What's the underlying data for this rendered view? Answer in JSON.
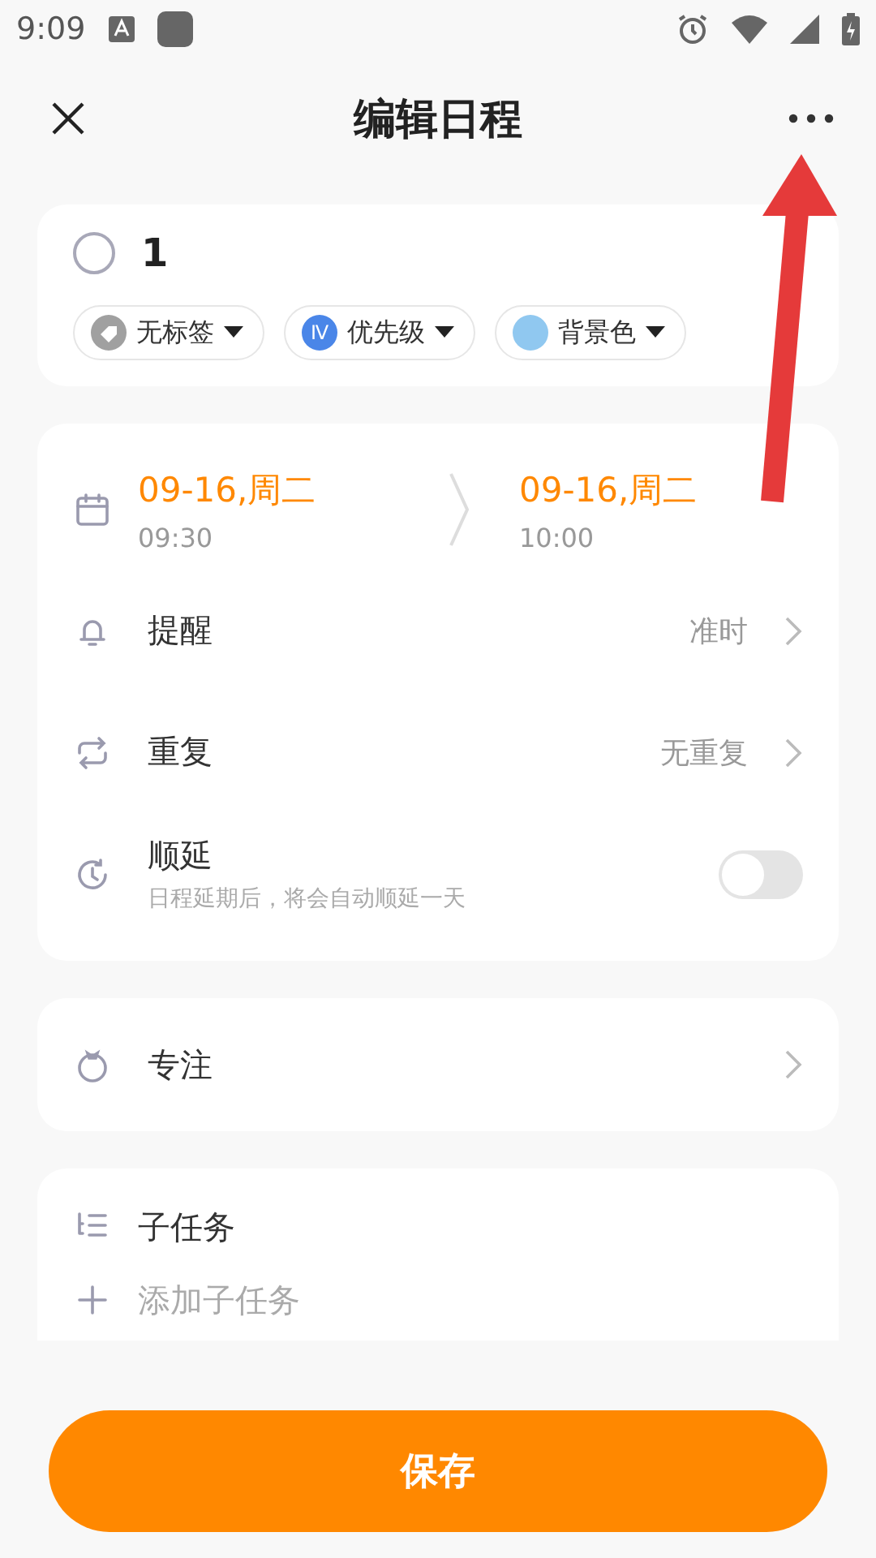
{
  "status_bar": {
    "time": "9:09"
  },
  "header": {
    "title": "编辑日程"
  },
  "task": {
    "checked": false,
    "title": "1",
    "chips": [
      {
        "kind": "tag",
        "label": "无标签"
      },
      {
        "kind": "priority",
        "label": "优先级",
        "badge": "Ⅳ"
      },
      {
        "kind": "color",
        "label": "背景色",
        "color": "#90c8f0"
      }
    ]
  },
  "schedule": {
    "start": {
      "date": "09-16,周二",
      "time": "09:30"
    },
    "end": {
      "date": "09-16,周二",
      "time": "10:00"
    },
    "rows": [
      {
        "kind": "nav",
        "label": "提醒",
        "value": "准时"
      },
      {
        "kind": "nav",
        "label": "重复",
        "value": "无重复"
      },
      {
        "kind": "toggle",
        "label": "顺延",
        "hint": "日程延期后，将会自动顺延一天",
        "on": false
      }
    ]
  },
  "focus": {
    "label": "专注"
  },
  "subtasks": {
    "label": "子任务",
    "add": "添加子任务"
  },
  "save_button": "保存"
}
